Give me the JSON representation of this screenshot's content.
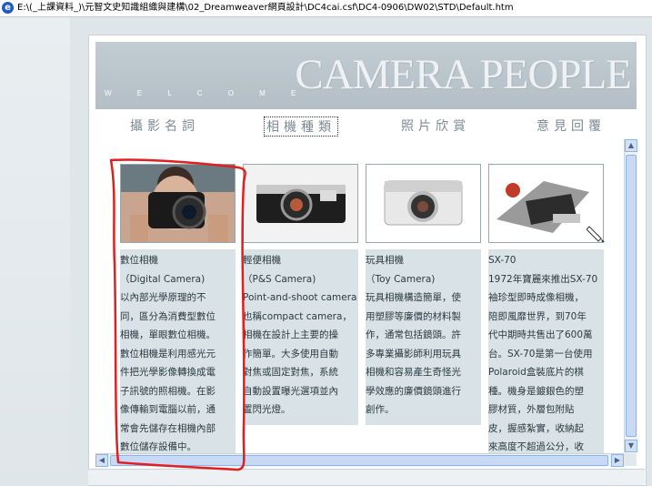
{
  "titlebar": {
    "path": "E:\\(_上課資料_)\\元智文史知識組織與建構\\02_Dreamweaver網頁設計\\DC4cai.csf\\DC4-0906\\DW02\\STD\\Default.htm"
  },
  "banner": {
    "welcome": "W E L C O M E",
    "brand": "CAMERA PEOPLE"
  },
  "nav": {
    "items": [
      {
        "label": "攝影名詞"
      },
      {
        "label": "相機種類"
      },
      {
        "label": "照片欣賞"
      },
      {
        "label": "意見回覆"
      }
    ]
  },
  "cards": [
    {
      "lines": [
        "數位相機",
        "（Digital Camera)",
        "以內部光學原理的不",
        "同，區分為消費型數位",
        "相機，單眼數位相機。",
        "數位相機是利用感光元",
        "件把光學影像轉換成電",
        "子訊號的照相機。在影",
        "像傳輸到電腦以前，通",
        "常會先儲存在相機內部",
        "數位儲存設備中。"
      ]
    },
    {
      "lines": [
        "輕便相機",
        "（P&S Camera)",
        "Point-and-shoot camera",
        "也稱compact camera，",
        "相機在設計上主要的操",
        "作簡單。大多使用自動",
        "對焦或固定對焦，系統",
        "自動設置曝光選項並內",
        "置閃光燈。"
      ]
    },
    {
      "lines": [
        "玩具相機",
        "（Toy Camera)",
        "玩具相機構造簡單，使",
        "用塑膠等廉價的材料製",
        "作，通常包括鏡頭。許",
        "多專業攝影師利用玩具",
        "相機和容易產生奇怪光",
        "學效應的廉價鏡頭進行",
        "創作。"
      ]
    },
    {
      "lines": [
        "SX-70",
        "1972年寶麗來推出SX-70",
        "袖珍型即時成像相機，",
        "陪即風靡世界，到70年",
        "代中期時共售出了600萬",
        "台。SX-70是第一台使用",
        "Polaroid盒裝底片的棋",
        "種。機身是鍍銀色的塑",
        "膠材質，外層包附貼",
        "皮，握感紮實，收納起",
        "來高度不超過公分，收"
      ]
    }
  ]
}
